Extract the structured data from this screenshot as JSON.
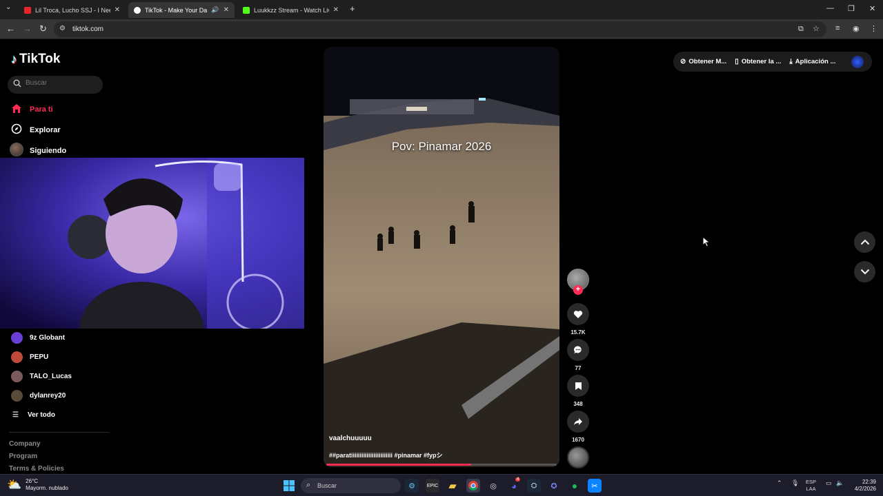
{
  "browser": {
    "tabs": [
      {
        "title": "Lil Troca, Lucho SSJ - I Need You",
        "icon_color": "#e8262b",
        "active": false
      },
      {
        "title": "TikTok - Make Your Day",
        "icon_color": "#ffffff",
        "active": true
      },
      {
        "title": "Luukkzz Stream - Watch Live on Kick",
        "icon_color": "#53fc18",
        "active": false
      }
    ],
    "url": "tiktok.com",
    "new_tab": "+",
    "window_controls": {
      "minimize": "—",
      "restore": "❐",
      "close": "✕"
    }
  },
  "tiktok": {
    "logo": "TikTok",
    "search_placeholder": "Buscar",
    "nav": [
      {
        "label": "Para ti",
        "icon": "home-icon",
        "active": true
      },
      {
        "label": "Explorar",
        "icon": "compass-icon",
        "active": false
      },
      {
        "label": "Siguiendo",
        "icon": "following-avatar",
        "active": false
      }
    ],
    "following_accounts": [
      {
        "name": "9z Globant",
        "color": "#6a3fd6"
      },
      {
        "name": "PEPU",
        "color": "#c04a3a"
      },
      {
        "name": "TALO_Lucas",
        "color": "#7a5a5a"
      },
      {
        "name": "dylanrey20",
        "color": "#5a4a3a"
      }
    ],
    "see_all": "Ver todo",
    "footer_links": [
      "Company",
      "Program",
      "Terms & Policies"
    ],
    "top_actions": [
      {
        "label": "Obtener M...",
        "icon": "coin-icon"
      },
      {
        "label": "Obtener la ...",
        "icon": "phone-icon"
      },
      {
        "label": "Aplicación ...",
        "icon": "download-icon"
      }
    ],
    "video": {
      "overlay_text": "Pov: Pinamar 2026",
      "author": "vaalchuuuuu",
      "caption": "##paratiiiiiiiiiiiiiiiiiiiiiiii #pinamar #fypシ",
      "progress": 0.63
    },
    "actions": {
      "likes": "15.7K",
      "comments": "77",
      "saves": "348",
      "shares": "1670"
    }
  },
  "taskbar": {
    "weather_temp": "26°C",
    "weather_desc": "Mayorm. nublado",
    "search_placeholder": "Buscar",
    "lang_top": "ESP",
    "lang_bottom": "LAA",
    "time": "22:39",
    "date": "4/2/2026",
    "discord_badge": "4"
  }
}
